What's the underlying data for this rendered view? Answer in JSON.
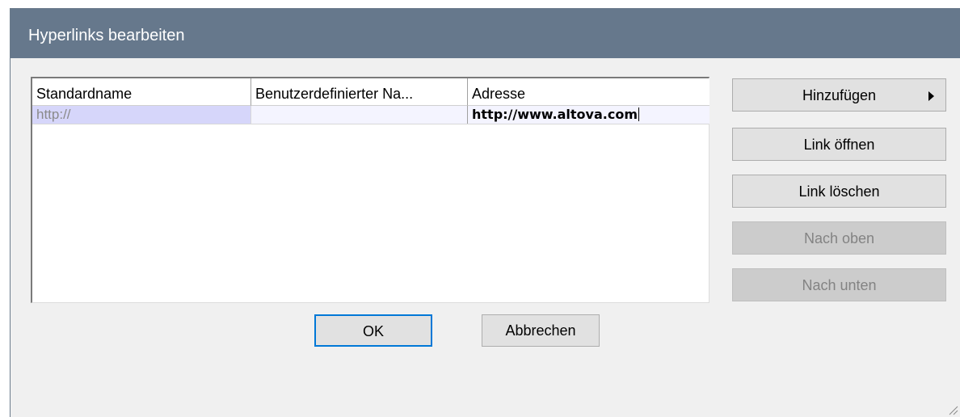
{
  "window": {
    "title": "Hyperlinks bearbeiten"
  },
  "table": {
    "columns": [
      "Standardname",
      "Benutzerdefinierter Na...",
      "Adresse"
    ],
    "rows": [
      {
        "standardname": "http://",
        "benutzername": "",
        "adresse": "http://www.altova.com"
      }
    ]
  },
  "buttons": {
    "add": "Hinzufügen",
    "open": "Link öffnen",
    "delete": "Link löschen",
    "up": "Nach oben",
    "down": "Nach unten",
    "ok": "OK",
    "cancel": "Abbrechen"
  },
  "colors": {
    "titlebar": "#66788c",
    "selection": "#d6d6fa",
    "focus": "#0078d7"
  }
}
